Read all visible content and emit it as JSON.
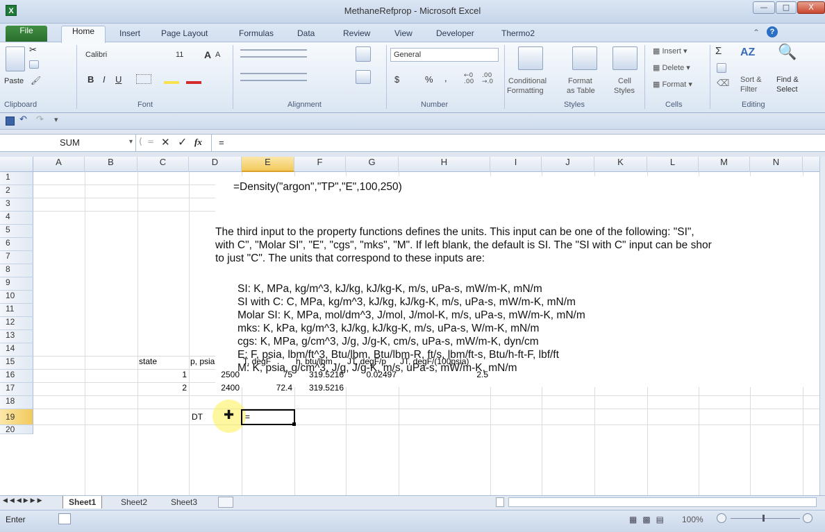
{
  "window": {
    "title": "MethaneRefprop - Microsoft Excel",
    "app_icon": "X"
  },
  "tabs": [
    "File",
    "Home",
    "Insert",
    "Page Layout",
    "Formulas",
    "Data",
    "Review",
    "View",
    "Developer",
    "Thermo2"
  ],
  "ribbon": {
    "clipboard": {
      "paste": "Paste",
      "label": "Clipboard"
    },
    "font": {
      "name": "Calibri",
      "size": "11",
      "bold": "B",
      "italic": "I",
      "underline": "U",
      "grow": "A",
      "shrink": "A",
      "label": "Font"
    },
    "alignment": {
      "label": "Alignment"
    },
    "number": {
      "format": "General",
      "currency": "$",
      "percent": "%",
      "comma": ",",
      "label": "Number"
    },
    "styles": {
      "conditional": "Conditional",
      "conditional2": "Formatting",
      "format_table": "Format",
      "format_table2": "as Table",
      "cell_styles": "Cell",
      "cell_styles2": "Styles",
      "label": "Styles"
    },
    "cells": {
      "insert": "Insert",
      "delete": "Delete",
      "format": "Format",
      "label": "Cells"
    },
    "editing": {
      "sigma": "Σ",
      "sort": "Sort &",
      "sort2": "Filter",
      "find": "Find &",
      "find2": "Select",
      "label": "Editing"
    }
  },
  "formula_bar": {
    "name_box": "SUM",
    "fx": "fx",
    "formula": "="
  },
  "columns": [
    "A",
    "B",
    "C",
    "D",
    "E",
    "F",
    "G",
    "H",
    "I",
    "J",
    "K",
    "L",
    "M",
    "N"
  ],
  "rows": [
    "1",
    "2",
    "3",
    "4",
    "5",
    "6",
    "7",
    "8",
    "9",
    "10",
    "11",
    "12",
    "13",
    "14",
    "15",
    "16",
    "17",
    "18",
    "19",
    "20"
  ],
  "textbox": {
    "formula_example": "=Density(\"argon\",\"TP\",\"E\",100,250)",
    "para1": "The third input to the property functions defines the units.  This input can be one of the following:  \"SI\",",
    "para2": "with C\", \"Molar SI\", \"E\", \"cgs\", \"mks\", \"M\".  If left blank, the default is SI.  The \"SI with C\" input can be shor",
    "para3": "to just \"C\".  The units that correspond to these inputs are:",
    "units": [
      "SI: K, MPa, kg/m^3, kJ/kg, kJ/kg-K, m/s, uPa-s, mW/m-K, mN/m",
      "SI with C: C, MPa, kg/m^3, kJ/kg, kJ/kg-K, m/s, uPa-s, mW/m-K, mN/m",
      "Molar SI: K, MPa, mol/dm^3, J/mol, J/mol-K, m/s, uPa-s, mW/m-K, mN/m",
      "mks: K, kPa, kg/m^3, kJ/kg, kJ/kg-K, m/s, uPa-s, W/m-K, mN/m",
      "cgs: K, MPa, g/cm^3, J/g, J/g-K, cm/s, uPa-s, mW/m-K, dyn/cm",
      "E: F, psia, lbm/ft^3, Btu/lbm, Btu/lbm-R, ft/s, lbm/ft-s, Btu/h-ft-F, lbf/ft",
      "M: K, psia, g/cm^3, J/g, J/g-K, m/s, uPa-s, mW/m-K, mN/m"
    ]
  },
  "table": {
    "headers": {
      "state": "state",
      "p": "p, psia",
      "t": "T, degF",
      "h": "h, btu/lbm",
      "jt1": "JT, degF/p",
      "jt2": "JT, degF/(100psia)"
    },
    "row16": {
      "state": "1",
      "p": "2500",
      "t": "75",
      "h": "319.5216",
      "jt1": "0.02497",
      "jt2": "2.5"
    },
    "row17": {
      "state": "2",
      "p": "2400",
      "t": "72.4",
      "h": "319.5216"
    },
    "row19": {
      "label": "DT",
      "active": "="
    }
  },
  "sheets": [
    "Sheet1",
    "Sheet2",
    "Sheet3"
  ],
  "status": {
    "mode": "Enter",
    "zoom": "100%"
  }
}
